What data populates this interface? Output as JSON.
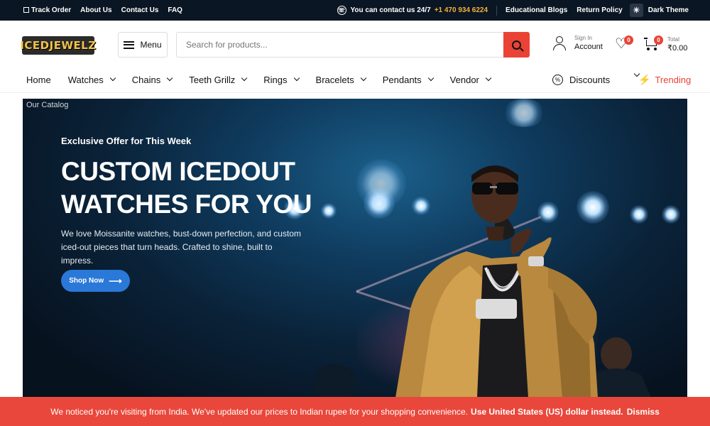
{
  "topbar": {
    "links": [
      "Track Order",
      "About Us",
      "Contact Us",
      "FAQ"
    ],
    "contact_text": "You can contact us 24/7",
    "phone": "+1 470 934 6224",
    "educational_blogs": "Educational Blogs",
    "return_policy": "Return Policy",
    "dark_theme": "Dark Theme"
  },
  "header": {
    "logo_text": "ICEDJEWELZ",
    "menu_label": "Menu",
    "search_placeholder": "Search for products...",
    "account_small": "Sign In",
    "account_big": "Account",
    "wishlist_count": "0",
    "cart_count": "0",
    "cart_small": "Total",
    "cart_total": "₹0.00"
  },
  "nav": {
    "items": [
      {
        "label": "Home",
        "dropdown": false
      },
      {
        "label": "Watches",
        "dropdown": true
      },
      {
        "label": "Chains",
        "dropdown": true
      },
      {
        "label": "Teeth Grillz",
        "dropdown": true
      },
      {
        "label": "Rings",
        "dropdown": true
      },
      {
        "label": "Bracelets",
        "dropdown": true
      },
      {
        "label": "Pendants",
        "dropdown": true
      },
      {
        "label": "Vendor",
        "dropdown": true
      }
    ],
    "discounts": "Discounts",
    "trending": "Trending"
  },
  "hero": {
    "catalog_label": "Our Catalog",
    "eyebrow": "Exclusive Offer for This Week",
    "headline": "CUSTOM ICEDOUT WATCHES FOR YOU",
    "description": "We love Moissanite watches, bust-down perfection, and custom iced-out pieces that turn heads. Crafted to shine, built to impress.",
    "cta": "Shop Now"
  },
  "banner": {
    "message": "We noticed you're visiting from India. We've updated our prices to Indian rupee for your shopping convenience.",
    "link": "Use United States (US) dollar instead.",
    "dismiss": "Dismiss"
  },
  "colors": {
    "topbar_bg": "#0b1624",
    "accent_red": "#ea4335",
    "phone_gold": "#f2b23a",
    "cta_blue": "#2a78d8",
    "banner_red": "#e9473b"
  }
}
